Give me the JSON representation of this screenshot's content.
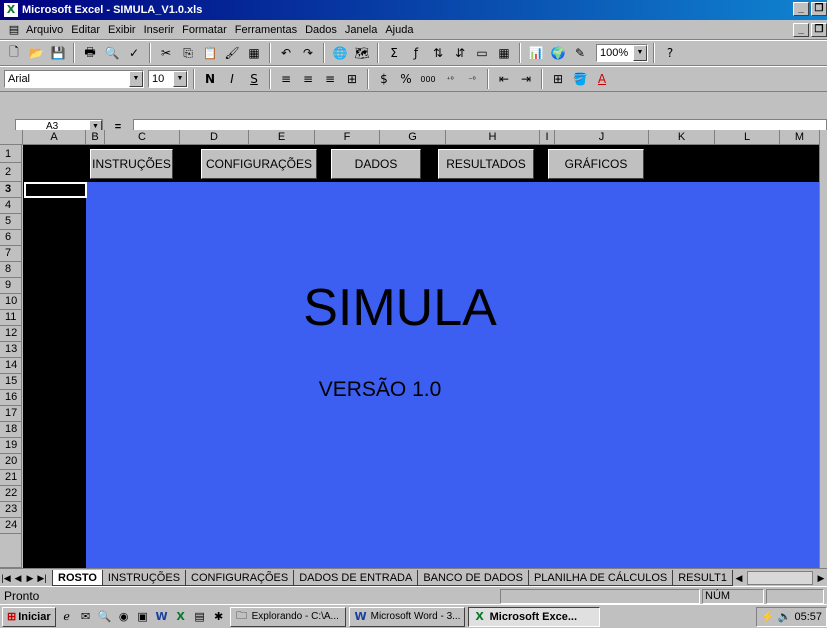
{
  "window": {
    "title": "Microsoft Excel - SIMULA_V1.0.xls",
    "app_letter": "X"
  },
  "menu": [
    "Arquivo",
    "Editar",
    "Exibir",
    "Inserir",
    "Formatar",
    "Ferramentas",
    "Dados",
    "Janela",
    "Ajuda"
  ],
  "toolbar": {
    "zoom": "100%"
  },
  "format": {
    "font": "Arial",
    "size": "10",
    "bold": "N",
    "italic": "I",
    "underline": "S",
    "percent": "%",
    "thousands": "000"
  },
  "formula": {
    "name_box": "A3",
    "equals": "="
  },
  "columns": [
    "A",
    "B",
    "C",
    "D",
    "E",
    "F",
    "G",
    "H",
    "I",
    "J",
    "K",
    "L",
    "M"
  ],
  "rows": [
    "1",
    "2",
    "3",
    "4",
    "5",
    "6",
    "7",
    "8",
    "9",
    "10",
    "11",
    "12",
    "13",
    "14",
    "15",
    "16",
    "17",
    "18",
    "19",
    "20",
    "21",
    "22",
    "23",
    "24"
  ],
  "nav_buttons": [
    "INSTRUÇÕES",
    "CONFIGURAÇÕES",
    "DADOS",
    "RESULTADOS",
    "GRÁFICOS"
  ],
  "sheet": {
    "title": "SIMULA",
    "version": "VERSÃO 1.0"
  },
  "tabs": [
    "ROSTO",
    "INSTRUÇÕES",
    "CONFIGURAÇÕES",
    "DADOS DE ENTRADA",
    "BANCO DE DADOS",
    "PLANILHA DE CÁLCULOS",
    "RESULT1"
  ],
  "status": {
    "text": "Pronto",
    "num": "NÚM"
  },
  "taskbar": {
    "start": "Iniciar",
    "tasks": [
      "Explorando - C:\\A...",
      "Microsoft Word - 3...",
      "Microsoft Exce..."
    ],
    "clock": "05:57"
  },
  "colors": {
    "sheet_bg": "#3c5ff2",
    "title_bar": "#000080"
  }
}
